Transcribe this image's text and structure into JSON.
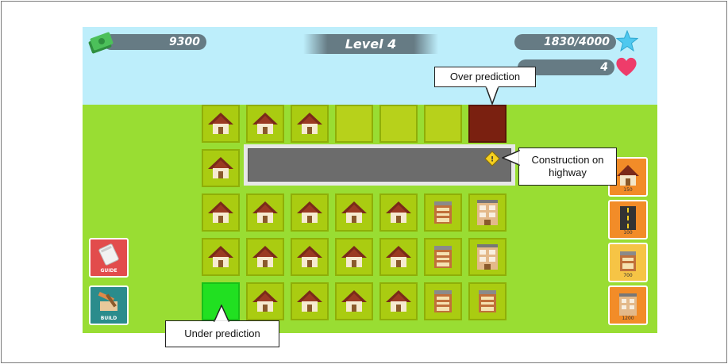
{
  "hud": {
    "money": "9300",
    "level": "Level 4",
    "score": "1830/4000",
    "lives": "4"
  },
  "buttons": {
    "guide": "GUIDE",
    "build": "BUILD"
  },
  "shop": [
    {
      "name": "house",
      "price": "150"
    },
    {
      "name": "road",
      "price": "100"
    },
    {
      "name": "shop",
      "price": "700"
    },
    {
      "name": "tower",
      "price": "1200"
    }
  ],
  "callouts": {
    "over": "Over prediction",
    "highway_line1": "Construction on",
    "highway_line2": "highway",
    "under": "Under prediction"
  },
  "grid": {
    "rows": [
      [
        "house",
        "house",
        "house",
        "empty",
        "empty",
        "empty",
        "over"
      ],
      [
        "house",
        "highway",
        "highway",
        "highway",
        "highway",
        "highway",
        "highway"
      ],
      [
        "house",
        "house",
        "house",
        "house",
        "house",
        "shop",
        "tower"
      ],
      [
        "house",
        "house",
        "house",
        "house",
        "house",
        "shop",
        "tower"
      ],
      [
        "under",
        "house",
        "house",
        "house",
        "house",
        "shop",
        "shop"
      ]
    ]
  },
  "colors": {
    "grass": "#99dd33",
    "sky": "#bdeefb",
    "tile": "#aacc11",
    "over_prediction": "#7a2010",
    "under_prediction": "#21e021"
  }
}
